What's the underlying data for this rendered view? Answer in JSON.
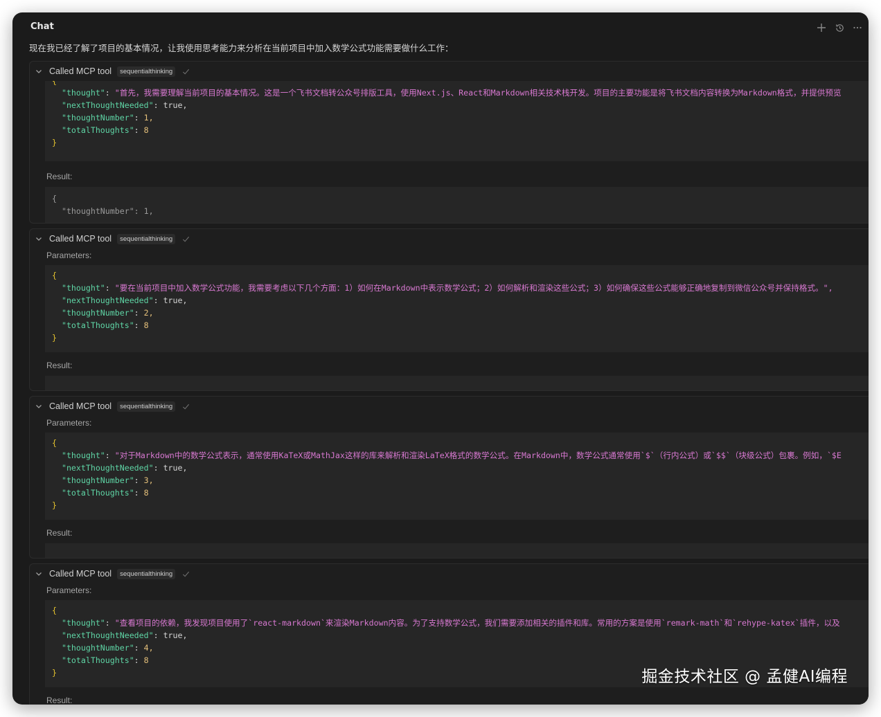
{
  "window": {
    "title": "Chat"
  },
  "top_actions": [
    "plus-icon",
    "history-icon",
    "more-icon"
  ],
  "intro": "现在我已经了解了项目的基本情况，让我使用思考能力来分析在当前项目中加入数学公式功能需要做什么工作：",
  "labels": {
    "called": "Called MCP tool",
    "tool": "sequentialthinking",
    "parameters": "Parameters:",
    "result": "Result:"
  },
  "json_keys": {
    "thought": "\"thought\"",
    "next": "\"nextThoughtNeeded\"",
    "number": "\"thoughtNumber\"",
    "total": "\"totalThoughts\""
  },
  "json_tokens": {
    "open": "{",
    "close": "}",
    "colon": ": ",
    "comma": ",",
    "true": "true,"
  },
  "calls": [
    {
      "thought": "\"首先，我需要理解当前项目的基本情况。这是一个飞书文档转公众号排版工具，使用Next.js、React和Markdown相关技术栈开发。项目的主要功能是将飞书文档内容转换为Markdown格式，并提供预览",
      "thoughtNumber": "1,",
      "totalThoughts": "8",
      "result_preview": "\"thoughtNumber\": 1,"
    },
    {
      "thought": "\"要在当前项目中加入数学公式功能，我需要考虑以下几个方面：1）如何在Markdown中表示数学公式；2）如何解析和渲染这些公式；3）如何确保这些公式能够正确地复制到微信公众号并保持格式。\",",
      "thoughtNumber": "2,",
      "totalThoughts": "8"
    },
    {
      "thought": "\"对于Markdown中的数学公式表示，通常使用KaTeX或MathJax这样的库来解析和渲染LaTeX格式的数学公式。在Markdown中，数学公式通常使用`$`（行内公式）或`$$`（块级公式）包裹。例如，`$E",
      "thoughtNumber": "3,",
      "totalThoughts": "8"
    },
    {
      "thought": "\"查看项目的依赖，我发现项目使用了`react-markdown`来渲染Markdown内容。为了支持数学公式，我们需要添加相关的插件和库。常用的方案是使用`remark-math`和`rehype-katex`插件，以及",
      "thoughtNumber": "4,",
      "totalThoughts": "8"
    }
  ],
  "watermark": "掘金技术社区 @ 孟健AI编程"
}
